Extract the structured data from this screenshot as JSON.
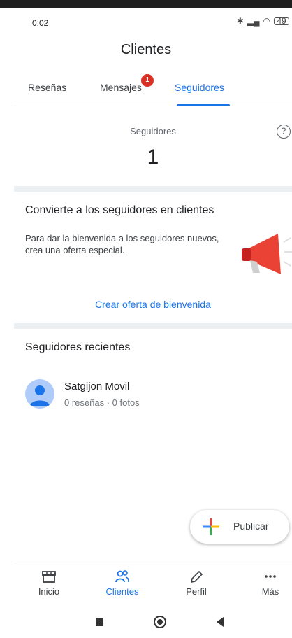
{
  "status_bar": {
    "time": "0:02",
    "battery": "49"
  },
  "header": {
    "title": "Clientes"
  },
  "tabs": [
    {
      "label": "Reseñas"
    },
    {
      "label": "Mensajes",
      "badge": "1"
    },
    {
      "label": "Seguidores",
      "active": true
    }
  ],
  "followers": {
    "label": "Seguidores",
    "count": "1"
  },
  "promo_card": {
    "title": "Convierte a los seguidores en clientes",
    "text": "Para dar la bienvenida a los seguidores nuevos, crea una oferta especial.",
    "link": "Crear oferta de bienvenida"
  },
  "recent": {
    "title": "Seguidores recientes",
    "items": [
      {
        "name": "Satgijon Movil",
        "meta": "0 reseñas · 0 fotos"
      }
    ]
  },
  "fab": {
    "label": "Publicar"
  },
  "bottom_nav": [
    {
      "label": "Inicio",
      "icon": "store-icon"
    },
    {
      "label": "Clientes",
      "icon": "people-icon",
      "active": true
    },
    {
      "label": "Perfil",
      "icon": "pencil-icon"
    },
    {
      "label": "Más",
      "icon": "more-icon"
    }
  ],
  "colors": {
    "accent": "#1a73e8",
    "badge": "#d93025",
    "megaphone": "#ea4335"
  }
}
